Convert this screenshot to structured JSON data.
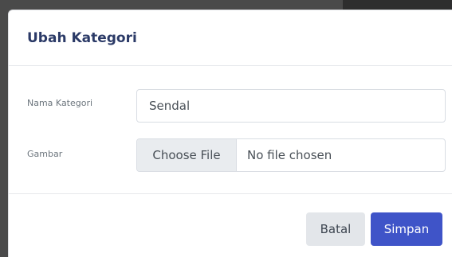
{
  "modal": {
    "title": "Ubah Kategori"
  },
  "form": {
    "name_label": "Nama Kategori",
    "name_value": "Sendal",
    "image_label": "Gambar",
    "file_button_label": "Choose File",
    "file_status": "No file chosen"
  },
  "footer": {
    "cancel_label": "Batal",
    "save_label": "Simpan"
  },
  "colors": {
    "title": "#2b3a67",
    "primary": "#3f54c8",
    "secondary": "#e3e6ea"
  }
}
